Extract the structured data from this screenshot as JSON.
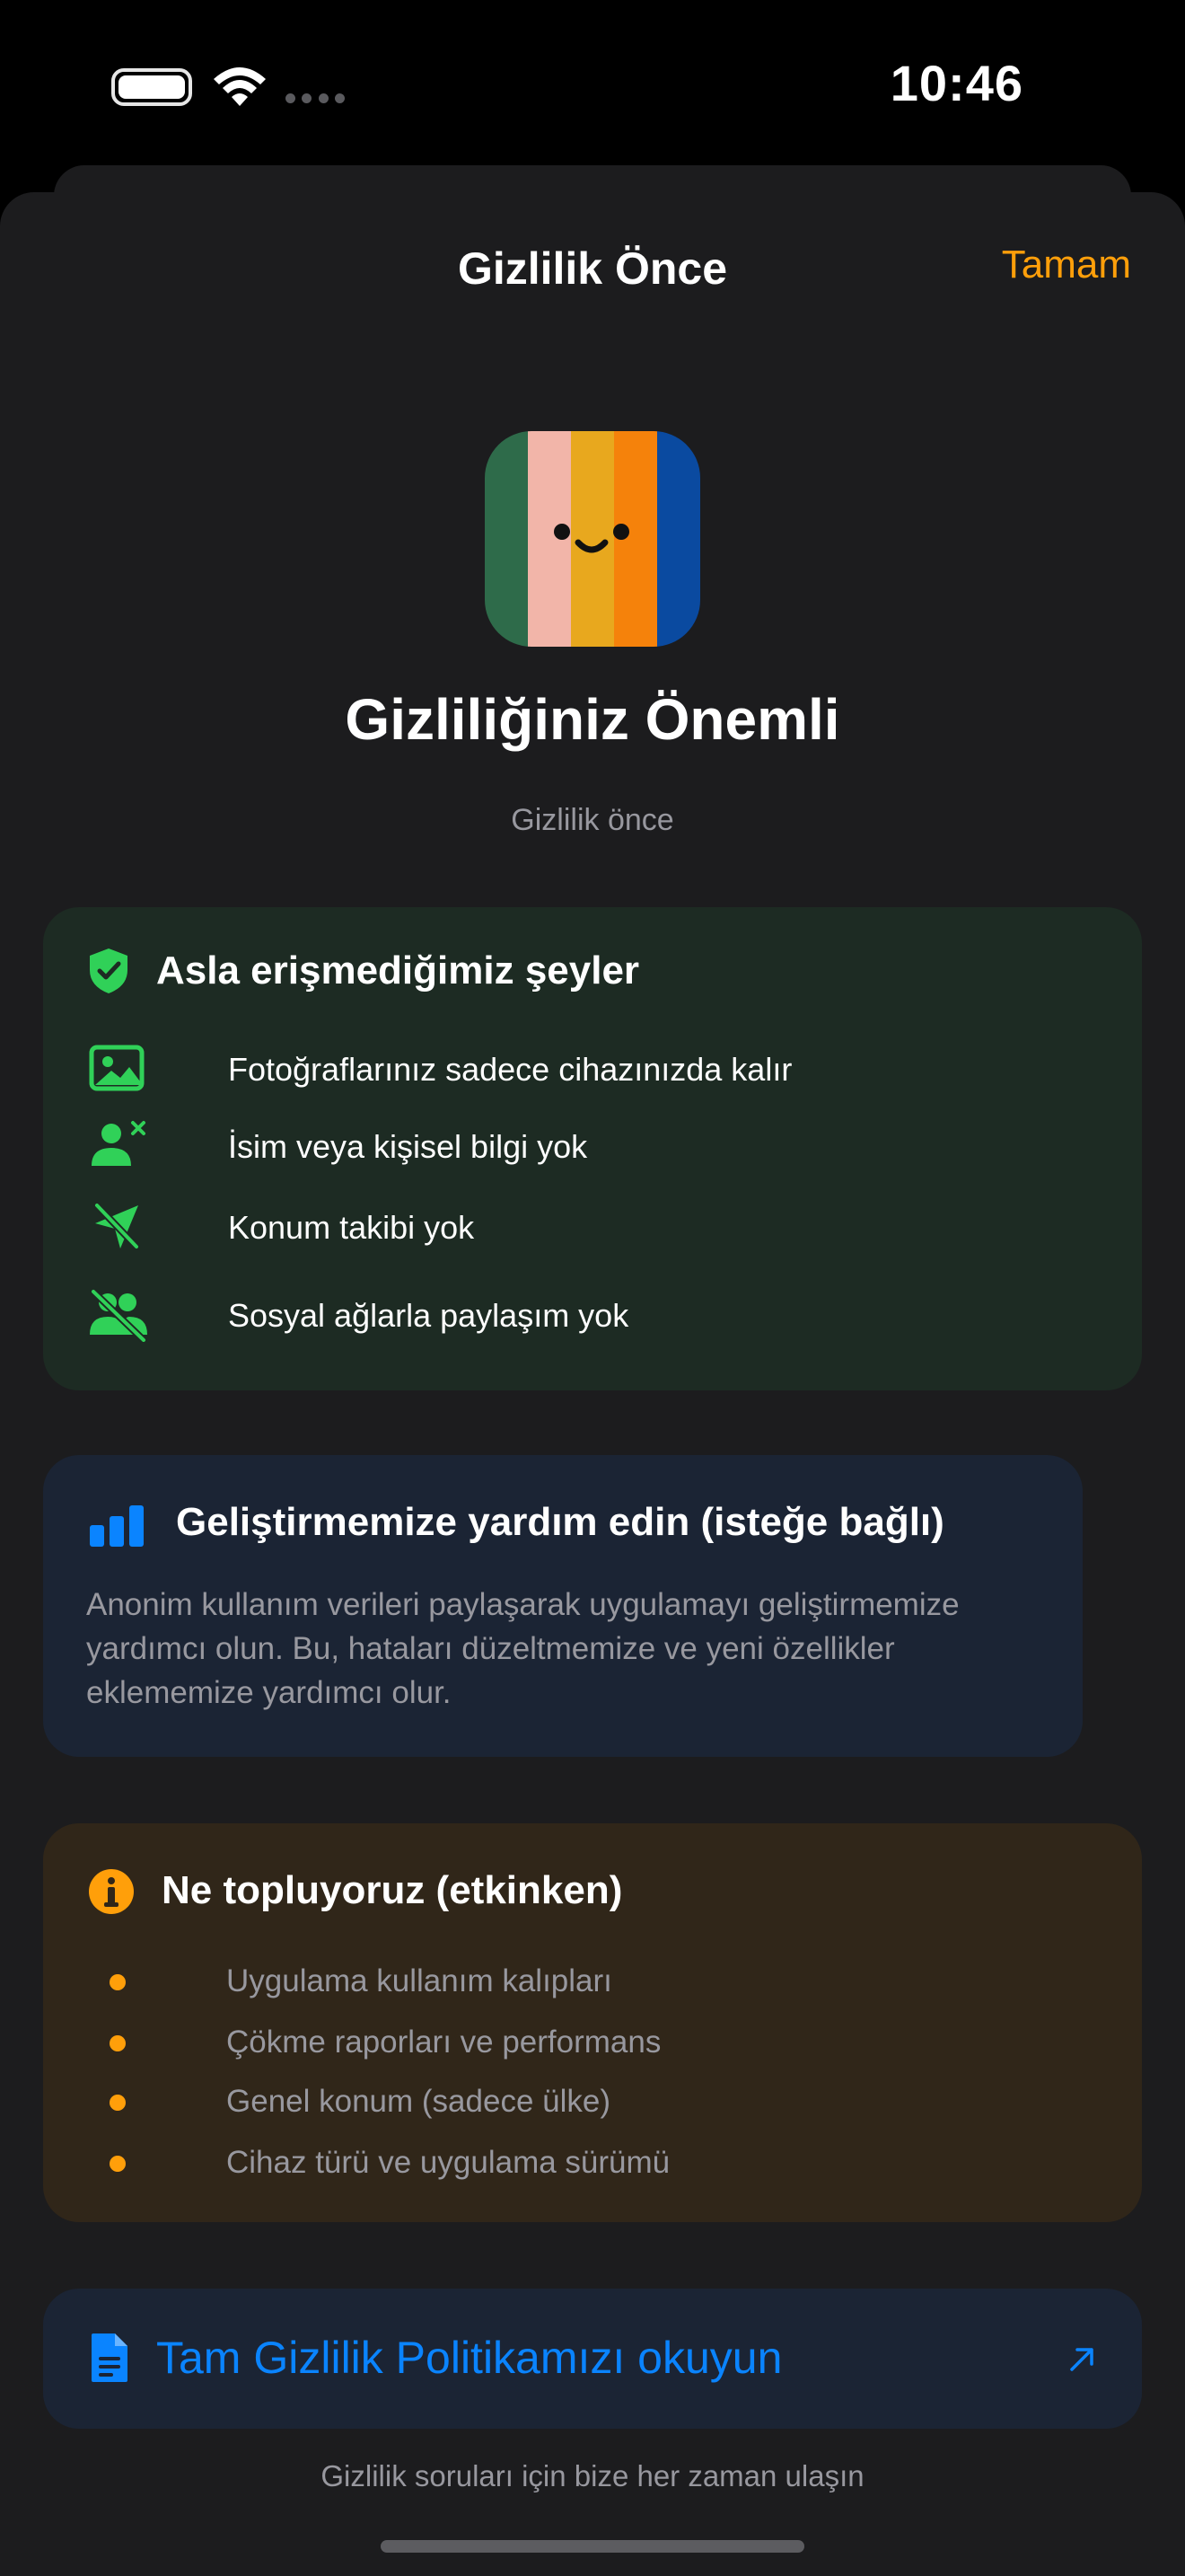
{
  "status_bar": {
    "time": "10:46"
  },
  "nav": {
    "title": "Gizlilik Önce",
    "done_label": "Tamam"
  },
  "hero": {
    "title": "Gizliliğiniz Önemli",
    "subtitle": "Gizlilik önce"
  },
  "never_access": {
    "title": "Asla erişmediğimiz şeyler",
    "icon": "checkmark-shield-icon",
    "items": [
      {
        "icon": "photo-icon",
        "label": "Fotoğraflarınız sadece cihazınızda kalır"
      },
      {
        "icon": "person-x-icon",
        "label": "İsim veya kişisel bilgi yok"
      },
      {
        "icon": "location-slash-icon",
        "label": "Konum takibi yok"
      },
      {
        "icon": "people-slash-icon",
        "label": "Sosyal ağlarla paylaşım yok"
      }
    ]
  },
  "help_improve": {
    "title": "Geliştirmemize yardım edin (isteğe bağlı)",
    "icon": "bar-chart-icon",
    "description": "Anonim kullanım verileri paylaşarak uygulamayı geliştirmemize yardımcı olun. Bu, hataları düzeltmemize ve yeni özellikler eklememize yardımcı olur."
  },
  "what_we_collect": {
    "title": "Ne topluyoruz (etkinken)",
    "icon": "info-icon",
    "items": [
      "Uygulama kullanım kalıpları",
      "Çökme raporları ve performans",
      "Genel konum (sadece ülke)",
      "Cihaz türü ve uygulama sürümü"
    ]
  },
  "policy_link": {
    "label": "Tam Gizlilik Politikamızı okuyun",
    "icon": "document-icon",
    "trailing_icon": "arrow-up-right-icon"
  },
  "footer": {
    "text": "Gizlilik soruları için bize her zaman ulaşın"
  },
  "colors": {
    "accent_orange": "#ff9f0a",
    "accent_green": "#30d158",
    "accent_blue": "#0a84ff",
    "sheet_bg": "#1c1c1e"
  }
}
